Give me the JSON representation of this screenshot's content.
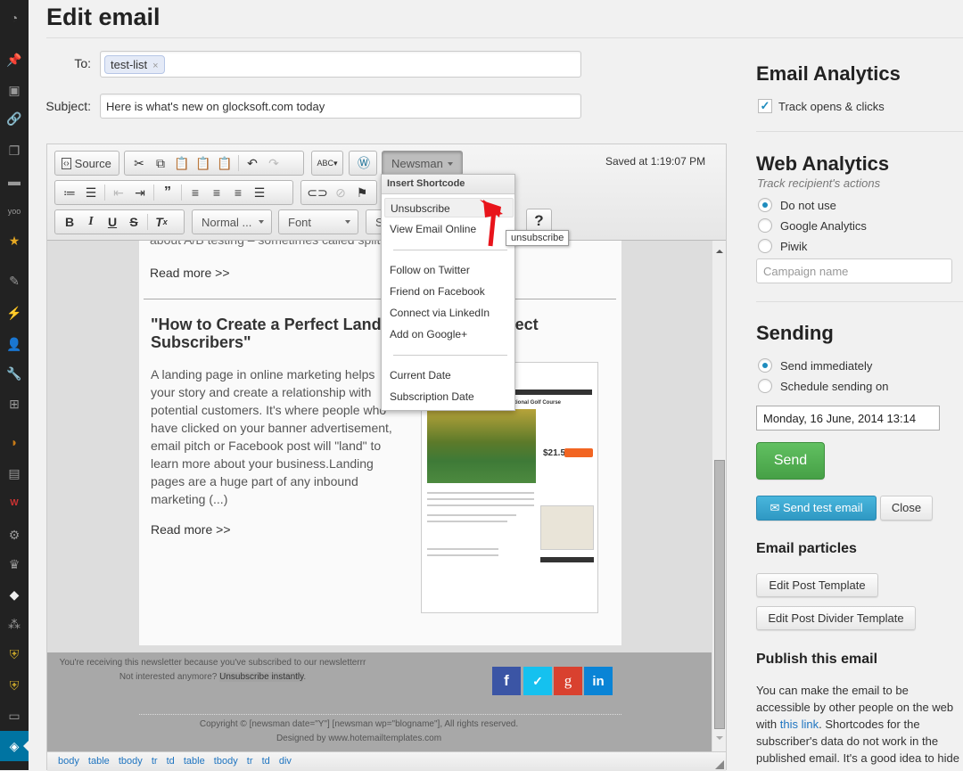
{
  "admin_menu": {
    "icons": [
      "dashboard-icon",
      "pin-icon",
      "media-icon",
      "link-icon",
      "pages-icon",
      "comments-icon",
      "yoo-icon",
      "star-icon",
      "appearance-icon",
      "plugins-icon",
      "users-icon",
      "tools-icon",
      "settings-sliders-icon",
      "plugin-orange-icon",
      "newsletter-icon",
      "wp-seo-icon",
      "gear-icon",
      "crown-icon",
      "cube-icon",
      "network-icon",
      "shield-icon",
      "shield-alt-icon",
      "archive-icon",
      "newsman-icon"
    ],
    "active_icon": "newsman-icon"
  },
  "page": {
    "title": "Edit email"
  },
  "form": {
    "to_label": "To:",
    "to_tags": [
      "test-list"
    ],
    "tag_remove": "×",
    "subject_label": "Subject:",
    "subject_value": "Here is what's new on glocksoft.com today"
  },
  "editor": {
    "toolbar": {
      "source_label": "Source",
      "format_combo": "Normal ...",
      "font_combo": "Font",
      "size_combo_partial": "S",
      "newsman_label": "Newsman",
      "help_label": "?",
      "saved_text": "Saved at 1:19:07 PM",
      "buttons_row1": [
        "cut",
        "copy",
        "paste",
        "paste-as-text",
        "paste-from-word",
        "undo",
        "redo",
        "spellcheck",
        "wordpress"
      ],
      "buttons_row2": [
        "numbered-list",
        "bulleted-list",
        "outdent",
        "indent",
        "blockquote",
        "align-left",
        "align-center",
        "align-right",
        "justify",
        "link",
        "unlink",
        "anchor"
      ],
      "buttons_row3": [
        "bold",
        "italic",
        "underline",
        "strikethrough",
        "remove-format"
      ]
    },
    "dropdown": {
      "header": "Insert Shortcode",
      "items": [
        "Unsubscribe",
        "View Email Online",
        "Follow on Twitter",
        "Friend on Facebook",
        "Connect via LinkedIn",
        "Add on Google+",
        "Current Date",
        "Subscription Date"
      ],
      "hovered": "Unsubscribe",
      "tooltip": "unsubscribe"
    },
    "content": {
      "truncated_line": "about A/B testing – sometimes called split",
      "read_more_1": "Read more >>",
      "post_title": "\"How to Create a Perfect Landing Page to Collect Subscribers\"",
      "post_title_visible_1": "\"How to Create a Perfect Land",
      "post_title_visible_1b": "ect",
      "post_title_visible_2": "Subscribers\"",
      "post_body_lines": [
        "A landing page in online marketing helps",
        "your story and create a relationship with",
        "potential customers. It's where people who",
        "have clicked on your banner advertisement,",
        "email pitch or Facebook post will \"land\" to",
        "learn more about your business.Landing",
        "pages are a huge part of any inbound",
        "marketing (...)"
      ],
      "read_more_2": "Read more >>",
      "thumb_title": "St. Croix National Golf Course",
      "thumb_price": "$21.50"
    },
    "footer": {
      "note_1": "You're receiving this newsletter because you've subscribed to our newsletterrr",
      "note_2_prefix": "Not interested anymore? ",
      "note_2_link": "Unsubscribe instantly",
      "note_2_suffix": ".",
      "copyright": "Copyright © [newsman date=\"Y\"] [newsman wp=\"blogname\"], All rights reserved.",
      "designed_by": "Designed by www.hotemailtemplates.com",
      "social": [
        {
          "name": "facebook",
          "glyph": "f",
          "color": "#3b55a5"
        },
        {
          "name": "twitter",
          "glyph": "🐦",
          "color": "#15c1ef"
        },
        {
          "name": "google-plus",
          "glyph": "g",
          "color": "#d9412f"
        },
        {
          "name": "linkedin",
          "glyph": "in",
          "color": "#0a84d6"
        }
      ]
    },
    "elements_path": [
      "body",
      "table",
      "tbody",
      "tr",
      "td",
      "table",
      "tbody",
      "tr",
      "td",
      "div"
    ]
  },
  "sidebar": {
    "email_analytics": {
      "title": "Email Analytics",
      "track_label": "Track opens & clicks",
      "track_checked": true
    },
    "web_analytics": {
      "title": "Web Analytics",
      "subtitle": "Track recipient's actions",
      "options": [
        "Do not use",
        "Google Analytics",
        "Piwik"
      ],
      "selected": "Do not use",
      "campaign_placeholder": "Campaign name"
    },
    "sending": {
      "title": "Sending",
      "options": [
        "Send immediately",
        "Schedule sending on"
      ],
      "selected": "Send immediately",
      "schedule_value": "Monday, 16 June, 2014 13:14",
      "send_label": "Send",
      "test_label": "Send test email",
      "close_label": "Close"
    },
    "particles": {
      "title": "Email particles",
      "edit_post_label": "Edit Post Template",
      "edit_divider_label": "Edit Post Divider Template"
    },
    "publish": {
      "title": "Publish this email",
      "text_1": "You can make the email to be accessible by other people on the web with ",
      "link": "this link",
      "text_2": ". Shortcodes for the subscriber's data do not work in the published email. It's a good idea to hide"
    }
  }
}
